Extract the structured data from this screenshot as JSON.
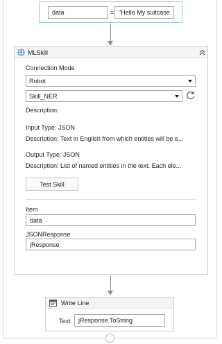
{
  "assign": {
    "to_value": "data",
    "operator": "=",
    "value": "\"Hello My suitcase"
  },
  "mlskill": {
    "title": "MLSkill",
    "connection_mode_label": "Connection Mode",
    "connection_mode_value": "Robot",
    "skill_value": "Skill_NER",
    "description_label": "Description:",
    "input_type": "Input Type:  JSON",
    "input_description": "Description:  Text in English from which entities will be e...",
    "output_type": "Output Type:  JSON",
    "output_description": "Description:  List of named entities in the text. Each ele...",
    "test_button": "Test Skill",
    "item_label": "Item",
    "item_value": "data",
    "json_response_label": "JSONResponse",
    "json_response_value": "jResponse"
  },
  "write_line": {
    "title": "Write Line",
    "text_label": "Text",
    "text_value": "jResponse.ToString"
  },
  "icons": [
    "mlskill-icon",
    "collapse-icon",
    "refresh-icon",
    "write-line-icon",
    "chevron-down-icon"
  ],
  "colors": {
    "border": "#d9d9d9",
    "connector": "#8e8e8e",
    "selected_border": "#9fc6e7",
    "header_bg": "#f4f4f4"
  }
}
